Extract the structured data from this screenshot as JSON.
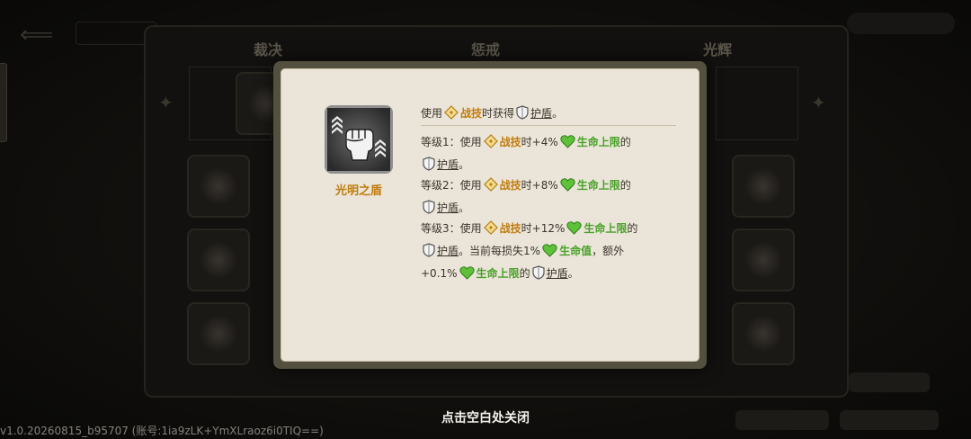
{
  "background": {
    "tabs": [
      "裁决",
      "惩戒",
      "光辉"
    ]
  },
  "popup": {
    "skill_name": "光明之盾",
    "skill_icon": "shield-fist-icon",
    "description": {
      "t1": "使用",
      "t2": "战技",
      "t3": "时获得",
      "t4": "护盾",
      "t5": "。"
    },
    "level1": {
      "a": "等级1：使用",
      "b": "战技",
      "c": "时+4%",
      "d": "生命上限",
      "e": "的",
      "f": "护盾",
      "g": "。"
    },
    "level2": {
      "a": "等级2：使用",
      "b": "战技",
      "c": "时+8%",
      "d": "生命上限",
      "e": "的",
      "f": "护盾",
      "g": "。"
    },
    "level3": {
      "a": "等级3：使用",
      "b": "战技",
      "c": "时+12%",
      "d": "生命上限",
      "e": "的",
      "f": "护盾",
      "g": "。当前每损失1%",
      "h": "生命值",
      "i": "，额外",
      "j": "+0.1%",
      "k": "生命上限",
      "l": "的",
      "m": "护盾",
      "n": "。"
    }
  },
  "colors": {
    "orange": "#c07c0e",
    "green": "#4aa02a",
    "panel": "#ebe5d9",
    "frame": "#54503f"
  },
  "close_hint": "点击空白处关闭",
  "version_text": "v1.0.20260815_b95707 (账号:1ia9zLK+YmXLraoz6i0TIQ==)"
}
